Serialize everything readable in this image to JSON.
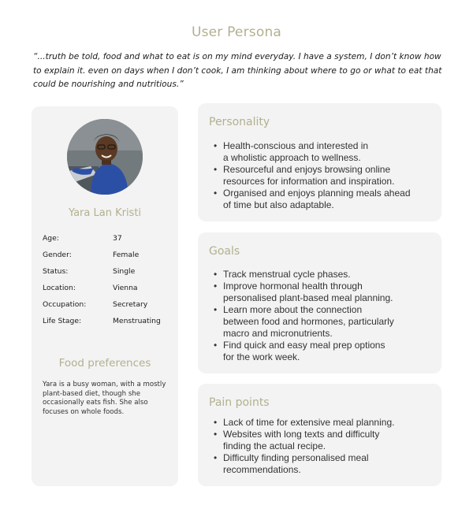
{
  "title": "User Persona",
  "quote": "“...truth be told, food and what to eat is on my mind everyday. I have a system, I don’t know how to explain it. even on days when I don’t cook, I am thinking about where to go or what to eat that could be nourishing and nutritious.”",
  "persona": {
    "name": "Yara Lan Kristi",
    "details": [
      {
        "label": "Age:",
        "value": "37"
      },
      {
        "label": "Gender:",
        "value": "Female"
      },
      {
        "label": "Status:",
        "value": "Single"
      },
      {
        "label": "Location:",
        "value": "Vienna"
      },
      {
        "label": "Occupation:",
        "value": "Secretary"
      },
      {
        "label": "Life Stage:",
        "value": "Menstruating"
      }
    ]
  },
  "food_preferences": {
    "title": "Food preferences",
    "text": "Yara is a busy woman, with a mostly plant-based diet, though she occasionally eats fish. She also focuses on whole foods."
  },
  "personality": {
    "title": "Personality",
    "items": [
      [
        "Health-conscious and interested in",
        "a wholistic approach to wellness."
      ],
      [
        "Resourceful and enjoys browsing online",
        "resources for information and inspiration."
      ],
      [
        "Organised and enjoys planning meals ahead",
        "of time but also adaptable."
      ]
    ]
  },
  "goals": {
    "title": "Goals",
    "items": [
      [
        "Track menstrual cycle phases."
      ],
      [
        "Improve hormonal health through",
        "personalised plant-based meal planning."
      ],
      [
        "Learn more about the connection",
        "between food and hormones, particularly",
        "macro and micronutrients."
      ],
      [
        "Find quick and easy meal prep options",
        "for the work week."
      ]
    ]
  },
  "pain_points": {
    "title": "Pain points",
    "items": [
      [
        "Lack of time for extensive meal planning."
      ],
      [
        "Websites with long texts and difficulty",
        "finding the actual recipe."
      ],
      [
        "Difficulty finding personalised meal",
        "recommendations."
      ]
    ]
  },
  "bullet": "•",
  "colors": {
    "accent": "#b3b08f",
    "card": "#f3f3f3"
  }
}
